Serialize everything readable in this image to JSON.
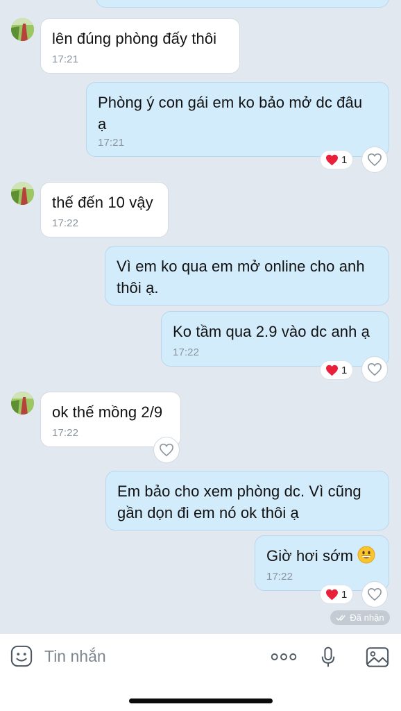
{
  "messages": [
    {
      "side": "in",
      "text": "lên đúng phòng đấy thôi",
      "time": "17:21"
    },
    {
      "side": "out",
      "text_line1": "Phòng ý con gái em ko bảo mở dc đâu",
      "text_line2": "ạ",
      "time": "17:21",
      "reaction": {
        "count": "1"
      }
    },
    {
      "side": "in",
      "text": "thế đến 10 vậy",
      "time": "17:22"
    },
    {
      "side": "out",
      "text_line1": "Vì em ko qua em mở online cho anh",
      "text_line2": "thôi ạ."
    },
    {
      "side": "out",
      "text": "Ko tầm qua 2.9 vào dc anh ạ",
      "time": "17:22",
      "reaction": {
        "count": "1"
      }
    },
    {
      "side": "in",
      "text": "ok thế mồng 2/9",
      "time": "17:22"
    },
    {
      "side": "out",
      "text_line1": "Em bảo cho xem phòng dc. Vì cũng",
      "text_line2": "gần dọn đi em nó ok thôi ạ"
    },
    {
      "side": "out",
      "text": "Giờ hơi sớm",
      "time": "17:22",
      "reaction": {
        "count": "1"
      }
    }
  ],
  "status": {
    "delivered": "Đã nhận"
  },
  "composer": {
    "placeholder": "Tin nhắn"
  },
  "icons": {
    "sticker": "sticker-icon",
    "more": "more-icon",
    "mic": "microphone-icon",
    "image": "image-icon",
    "heart": "heart-icon",
    "like": "heart-outline-icon",
    "emoji": "grinning-face-emoji"
  },
  "colors": {
    "background": "#e2e8ef",
    "incoming_bubble": "#ffffff",
    "outgoing_bubble": "#d3ecfb",
    "reaction_heart": "#e8203a"
  }
}
